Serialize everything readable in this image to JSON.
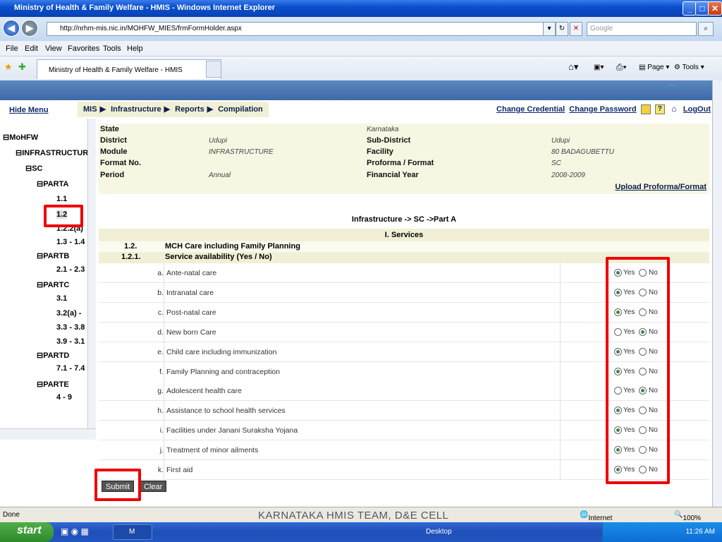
{
  "window": {
    "title": "Ministry of Health & Family Welfare - HMIS - Windows Internet Explorer"
  },
  "browser": {
    "url": "http://nrhm-mis.nic.in/MOHFW_MIES/frmFormHolder.aspx",
    "search_placeholder": "Google",
    "menu": [
      "File",
      "Edit",
      "View",
      "Favorites",
      "Tools",
      "Help"
    ],
    "tab_title": "Ministry of Health & Family Welfare - HMIS",
    "tools": {
      "page": "Page",
      "tools": "Tools"
    }
  },
  "header": {
    "hide_menu": "Hide Menu",
    "breadcrumb": [
      "MIS",
      "Infrastructure",
      "Reports",
      "Compilation"
    ],
    "links": {
      "change_credential": "Change Credential",
      "change_password": "Change Password",
      "logout": "LogOut"
    }
  },
  "tree": {
    "root": "MoHFW",
    "infra": "INFRASTRUCTURE",
    "sc": "SC",
    "parta": "PARTA",
    "parta_items": [
      "1.1",
      "1.2",
      "1.2.2(a)",
      "1.3 - 1.4"
    ],
    "partb": "PARTB",
    "partb_items": [
      "2.1 - 2.3"
    ],
    "partc": "PARTC",
    "partc_items": [
      "3.1",
      "3.2(a) -",
      "3.3 - 3.8",
      "3.9 - 3.1"
    ],
    "partd": "PARTD",
    "partd_items": [
      "7.1 - 7.4"
    ],
    "parte": "PARTE",
    "parte_items": [
      "4 - 9"
    ]
  },
  "info": {
    "state_label": "State",
    "state_value": "Karnataka",
    "district_label": "District",
    "district_value": "Udupi",
    "subdistrict_label": "Sub-District",
    "subdistrict_value": "Udupi",
    "module_label": "Module",
    "module_value": "INFRASTRUCTURE",
    "facility_label": "Facility",
    "facility_value": "80 BADAGUBETTU",
    "format_label": "Format No.",
    "proforma_label": "Proforma / Format",
    "proforma_value": "SC",
    "period_label": "Period",
    "period_value": "Annual",
    "fy_label": "Financial Year",
    "fy_value": "2008-2009",
    "upload": "Upload Proforma/Format"
  },
  "form": {
    "heading": "Infrastructure -> SC ->Part A",
    "section": "I. Services",
    "sub1_no": "1.2.",
    "sub1_title": "MCH Care including Family Planning",
    "sub2_no": "1.2.1.",
    "sub2_title": "Service availability (Yes / No)",
    "yes_label": "Yes",
    "no_label": "No",
    "items": [
      {
        "no": "a.",
        "label": "Ante-natal care",
        "value": "Yes"
      },
      {
        "no": "b.",
        "label": "Intranatal care",
        "value": "Yes"
      },
      {
        "no": "c.",
        "label": "Post-natal care",
        "value": "Yes"
      },
      {
        "no": "d.",
        "label": "New born Care",
        "value": "No"
      },
      {
        "no": "e.",
        "label": "Child care including immunization",
        "value": "Yes"
      },
      {
        "no": "f.",
        "label": "Family Planning and contraception",
        "value": "Yes"
      },
      {
        "no": "g.",
        "label": "Adolescent health care",
        "value": "No"
      },
      {
        "no": "h.",
        "label": "Assistance to school health services",
        "value": "Yes"
      },
      {
        "no": "i.",
        "label": "Facilities under Janani Suraksha Yojana",
        "value": "Yes"
      },
      {
        "no": "j.",
        "label": "Treatment of minor ailments",
        "value": "Yes"
      },
      {
        "no": "k.",
        "label": "First aid",
        "value": "Yes"
      }
    ],
    "submit": "Submit",
    "clear": "Clear"
  },
  "status": {
    "left": "Done",
    "zone": "Internet",
    "zoom": "100%"
  },
  "watermark": "KARNATAKA HMIS TEAM, D&E CELL",
  "taskbar": {
    "start": "start",
    "task": "M",
    "desktop": "Desktop",
    "clock": "11:26 AM"
  }
}
